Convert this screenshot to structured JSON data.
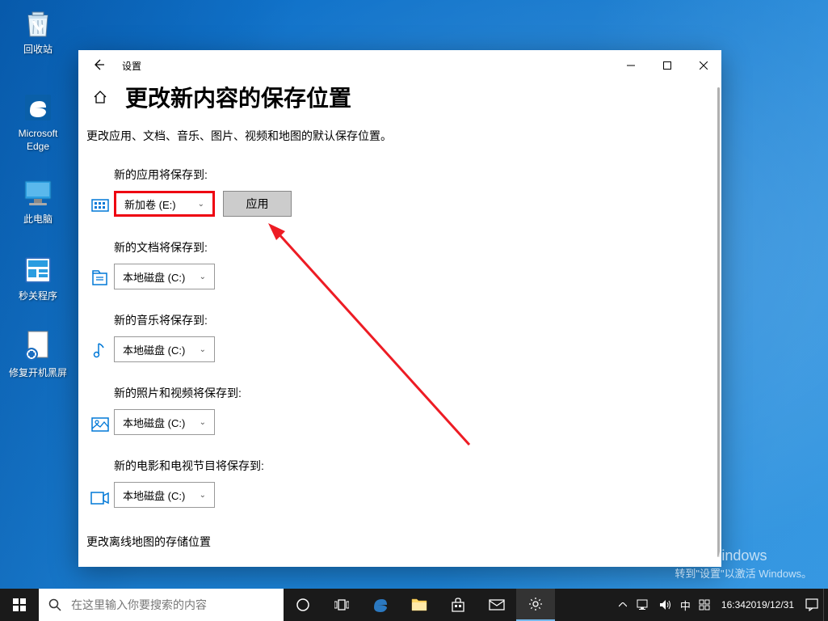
{
  "desktop_icons": {
    "recycle": "回收站",
    "edge": "Microsoft Edge",
    "pc": "此电脑",
    "program": "秒关程序",
    "repair": "修复开机黑屏"
  },
  "window": {
    "title": "设置",
    "page_title": "更改新内容的保存位置",
    "subtitle": "更改应用、文档、音乐、图片、视频和地图的默认保存位置。",
    "groups": {
      "apps": {
        "label": "新的应用将保存到:",
        "value": "新加卷 (E:)"
      },
      "docs": {
        "label": "新的文档将保存到:",
        "value": "本地磁盘 (C:)"
      },
      "music": {
        "label": "新的音乐将保存到:",
        "value": "本地磁盘 (C:)"
      },
      "photos": {
        "label": "新的照片和视频将保存到:",
        "value": "本地磁盘 (C:)"
      },
      "movies": {
        "label": "新的电影和电视节目将保存到:",
        "value": "本地磁盘 (C:)"
      }
    },
    "apply_label": "应用",
    "link": "更改离线地图的存储位置"
  },
  "taskbar": {
    "search_placeholder": "在这里输入你要搜索的内容",
    "ime": "中",
    "time": "16:34",
    "date": "2019/12/31"
  },
  "watermark": {
    "line1": "激活 Windows",
    "line2": "转到\"设置\"以激活 Windows。"
  }
}
